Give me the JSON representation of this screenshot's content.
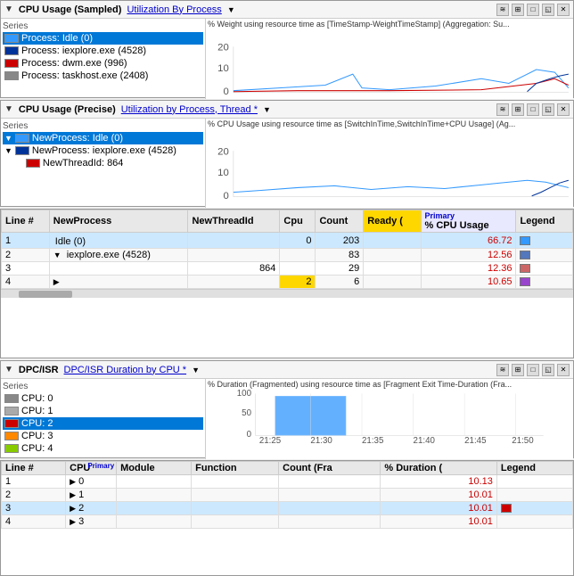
{
  "panels": {
    "panel1": {
      "title": "CPU Usage (Sampled)",
      "tab": "Utilization By Process",
      "series_label": "Series",
      "series": [
        {
          "label": "Process: Idle (0)",
          "color": "#3399ff",
          "selected": true
        },
        {
          "label": "Process: iexplore.exe (4528)",
          "color": "#003399"
        },
        {
          "label": "Process: dwm.exe (996)",
          "color": "#cc0000"
        },
        {
          "label": "Process: taskhost.exe (2408)",
          "color": "#888888"
        }
      ],
      "chart_ylabel": "% Weight using resource time as [TimeStamp-WeightTimeStamp] (Aggregation: Su..."
    },
    "panel2": {
      "title": "CPU Usage (Precise)",
      "tab": "Utilization by Process, Thread *",
      "series_label": "Series",
      "series": [
        {
          "label": "NewProcess: Idle (0)",
          "color": "#3399ff",
          "selected": true,
          "expanded": true
        },
        {
          "label": "NewProcess: iexplore.exe (4528)",
          "color": "#003399",
          "expanded": true
        },
        {
          "label": "NewThreadId: 864",
          "color": "#cc0000"
        }
      ],
      "chart_ylabel": "% CPU Usage using resource time as [SwitchInTime,SwitchInTime+CPU Usage] (Ag..."
    },
    "table1": {
      "columns": [
        "Line #",
        "NewProcess",
        "NewThreadId",
        "Cpu",
        "Count",
        "Ready (",
        "% CPU Usage",
        "Legend"
      ],
      "rows": [
        {
          "line": "1",
          "process": "Idle (0)",
          "threadid": "",
          "cpu": "0",
          "count": "203",
          "ready": "",
          "pct": "66.72",
          "color": "#3399ff",
          "indent": 0,
          "selected": true,
          "expand": false
        },
        {
          "line": "2",
          "process": "iexplore.exe (4528)",
          "threadid": "",
          "cpu": "",
          "count": "83",
          "ready": "",
          "pct": "12.56",
          "color": "#5577bb",
          "indent": 1,
          "selected": false,
          "expand": true
        },
        {
          "line": "3",
          "process": "",
          "threadid": "864",
          "cpu": "",
          "count": "29",
          "ready": "",
          "pct": "12.36",
          "color": "#cc6666",
          "indent": 2,
          "selected": false,
          "expand": false
        },
        {
          "line": "4",
          "process": "",
          "threadid": "",
          "cpu": "2",
          "count": "6",
          "ready": "",
          "pct": "10.65",
          "color": "#9944cc",
          "indent": 0,
          "selected": false,
          "expand": false,
          "gold": true
        }
      ]
    },
    "panel4": {
      "title": "DPC/ISR",
      "tab": "DPC/ISR Duration by CPU *",
      "series_label": "Series",
      "series": [
        {
          "label": "CPU: 0",
          "color": "#888888"
        },
        {
          "label": "CPU: 1",
          "color": "#aaaaaa"
        },
        {
          "label": "CPU: 2",
          "color": "#cc0000",
          "selected": true
        },
        {
          "label": "CPU: 3",
          "color": "#ff8800"
        },
        {
          "label": "CPU: 4",
          "color": "#88cc00"
        }
      ],
      "chart_ylabel": "% Duration (Fragmented) using resource time as [Fragment Exit Time-Duration (Fra..."
    },
    "table2": {
      "columns": [
        "Line #",
        "CPU",
        "Module",
        "Function",
        "Count (Fra",
        "% Duration (",
        "Legend"
      ],
      "rows": [
        {
          "line": "1",
          "cpu": "0",
          "module": "",
          "function": "",
          "count": "",
          "pct": "10.13",
          "color": "#cc3300",
          "selected": false
        },
        {
          "line": "2",
          "cpu": "1",
          "module": "",
          "function": "",
          "count": "",
          "pct": "10.01",
          "color": "#cc3300",
          "selected": false
        },
        {
          "line": "3",
          "cpu": "2",
          "module": "",
          "function": "",
          "count": "",
          "pct": "10.01",
          "color": "#cc0000",
          "selected": true
        },
        {
          "line": "4",
          "cpu": "3",
          "module": "",
          "function": "",
          "count": "",
          "pct": "10.01",
          "color": "#cc3300",
          "selected": false
        }
      ]
    }
  },
  "ui": {
    "expand_arrow": "▶",
    "collapse_arrow": "▼",
    "right_arrow": "▶",
    "dropdown_arrow": "▼",
    "window_icons": [
      "─",
      "□",
      "✕"
    ],
    "chart_values": [
      0,
      10,
      20
    ],
    "chart_values2": [
      0,
      50,
      100
    ],
    "timestamps": [
      "21:25",
      "21:30",
      "21:35",
      "21:40",
      "21:45",
      "21:50"
    ],
    "primary_label": "Primary",
    "count_label": "Count",
    "ready_label": "Ready ("
  }
}
